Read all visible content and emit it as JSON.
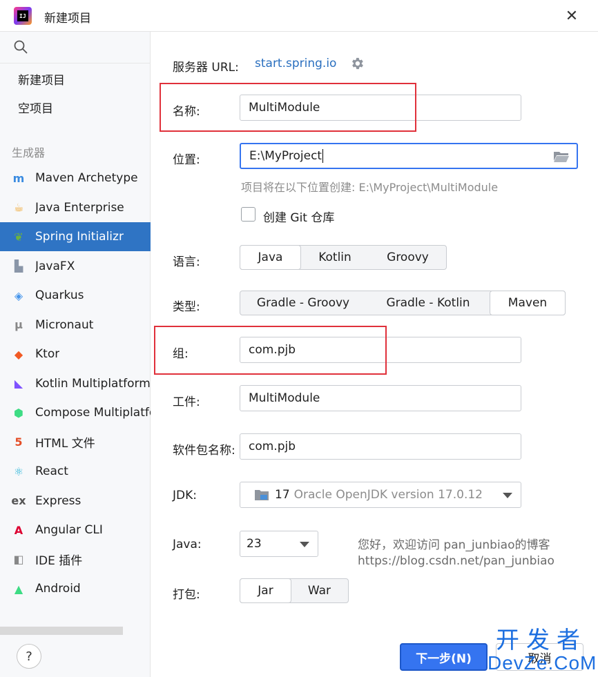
{
  "window": {
    "title": "新建项目",
    "close_glyph": "✕",
    "app_icon_text": "IJ"
  },
  "sidebar": {
    "search_placeholder": "",
    "top_items": [
      "新建项目",
      "空项目"
    ],
    "section_label": "生成器",
    "generators": [
      {
        "label": "Maven Archetype",
        "icon": "maven-icon",
        "color": "#3a8be0"
      },
      {
        "label": "Java Enterprise",
        "icon": "java-enterprise-icon",
        "color": "#f0a020"
      },
      {
        "label": "Spring Initializr",
        "icon": "spring-icon",
        "color": "#6db33f",
        "selected": true
      },
      {
        "label": "JavaFX",
        "icon": "javafx-icon",
        "color": "#8a96a8"
      },
      {
        "label": "Quarkus",
        "icon": "quarkus-icon",
        "color": "#4695eb"
      },
      {
        "label": "Micronaut",
        "icon": "micronaut-icon",
        "color": "#888888"
      },
      {
        "label": "Ktor",
        "icon": "ktor-icon",
        "color": "#f15a24"
      },
      {
        "label": "Kotlin Multiplatform",
        "icon": "kotlin-icon",
        "color": "#7f52ff"
      },
      {
        "label": "Compose Multiplatform",
        "icon": "compose-icon",
        "color": "#3ddc84"
      },
      {
        "label": "HTML 文件",
        "icon": "html5-icon",
        "color": "#e44d26"
      },
      {
        "label": "React",
        "icon": "react-icon",
        "color": "#2bb5d8"
      },
      {
        "label": "Express",
        "icon": "express-icon",
        "color": "#555555"
      },
      {
        "label": "Angular CLI",
        "icon": "angular-icon",
        "color": "#dd0031"
      },
      {
        "label": "IDE 插件",
        "icon": "ide-plugin-icon",
        "color": "#888888"
      },
      {
        "label": "Android",
        "icon": "android-icon",
        "color": "#3ddc84"
      }
    ],
    "help_glyph": "?"
  },
  "form": {
    "server_url_label": "服务器 URL:",
    "server_url_value": "start.spring.io",
    "name_label": "名称:",
    "name_value": "MultiModule",
    "location_label": "位置:",
    "location_value": "E:\\MyProject",
    "location_hint": "项目将在以下位置创建: E:\\MyProject\\MultiModule",
    "git_checkbox_label": "创建 Git 仓库",
    "git_checked": false,
    "language_label": "语言:",
    "language_options": [
      "Java",
      "Kotlin",
      "Groovy"
    ],
    "language_selected": "Java",
    "type_label": "类型:",
    "type_options": [
      "Gradle - Groovy",
      "Gradle - Kotlin",
      "Maven"
    ],
    "type_selected": "Maven",
    "group_label": "组:",
    "group_value": "com.pjb",
    "artifact_label": "工件:",
    "artifact_value": "MultiModule",
    "package_label": "软件包名称:",
    "package_value": "com.pjb",
    "jdk_label": "JDK:",
    "jdk_version": "17",
    "jdk_name": "Oracle OpenJDK version 17.0.12",
    "java_label": "Java:",
    "java_value": "23",
    "packaging_label": "打包:",
    "packaging_options": [
      "Jar",
      "War"
    ],
    "packaging_selected": "Jar",
    "note_line1": "您好，欢迎访问 pan_junbiao的博客",
    "note_line2": "https://blog.csdn.net/pan_junbiao"
  },
  "footer": {
    "next_label": "下一步(N)",
    "cancel_label": "取消"
  },
  "watermark": {
    "line1": "开发者",
    "line2": "DevZe.CoM"
  },
  "colors": {
    "accent": "#3574f0",
    "selection": "#2f74c4",
    "link": "#2a6fbf",
    "highlight_box": "#e0303a"
  }
}
